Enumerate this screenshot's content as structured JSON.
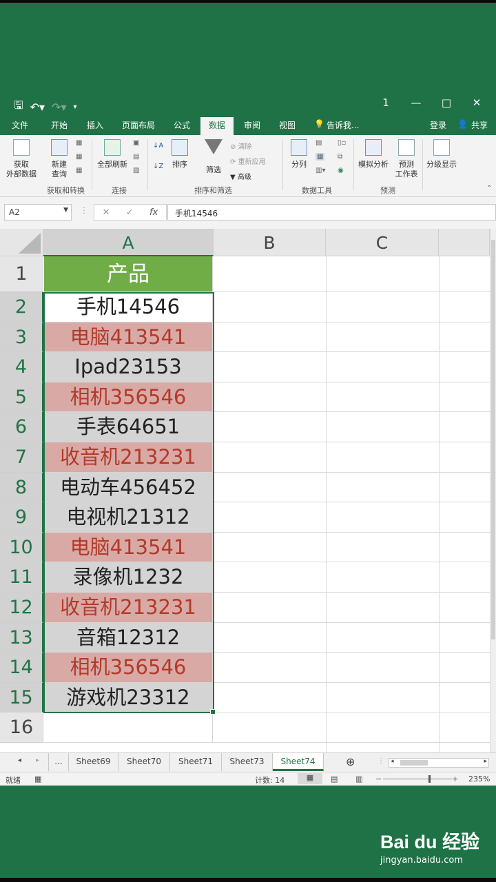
{
  "titlebar": {
    "undo_icon": "undo-icon",
    "redo_icon": "redo-icon",
    "minimize": "1",
    "restore": "□",
    "close": "✕"
  },
  "tabs": {
    "items": [
      "文件",
      "开始",
      "插入",
      "页面布局",
      "公式",
      "数据",
      "审阅",
      "视图"
    ],
    "active": "数据",
    "tell_me": "告诉我...",
    "login": "登录",
    "share": "共享"
  },
  "ribbon": {
    "get_data": "获取\n外部数据",
    "new_query": "新建\n查询",
    "group_get": "获取和转换",
    "refresh_all": "全部刷新",
    "group_conn": "连接",
    "sort": "排序",
    "filter": "筛选",
    "clear": "清除",
    "reapply": "重新应用",
    "advanced": "高级",
    "group_sort": "排序和筛选",
    "text_to_columns": "分列",
    "group_tools": "数据工具",
    "what_if": "模拟分析",
    "forecast": "预测\n工作表",
    "group_forecast": "预测",
    "outline": "分级显示"
  },
  "formula_bar": {
    "name_box": "A2",
    "cancel": "✕",
    "enter": "✓",
    "fx": "fx",
    "content": "手机14546"
  },
  "grid": {
    "columns": [
      "A",
      "B",
      "C"
    ],
    "rows": [
      {
        "num": "1",
        "value": "产品",
        "style": "header"
      },
      {
        "num": "2",
        "value": "手机14546",
        "style": "white"
      },
      {
        "num": "3",
        "value": "电脑413541",
        "style": "pink"
      },
      {
        "num": "4",
        "value": "Ipad23153",
        "style": "gray"
      },
      {
        "num": "5",
        "value": "相机356546",
        "style": "pink"
      },
      {
        "num": "6",
        "value": "手表64651",
        "style": "gray"
      },
      {
        "num": "7",
        "value": "收音机213231",
        "style": "pink"
      },
      {
        "num": "8",
        "value": "电动车456452",
        "style": "gray"
      },
      {
        "num": "9",
        "value": "电视机21312",
        "style": "gray"
      },
      {
        "num": "10",
        "value": "电脑413541",
        "style": "pink"
      },
      {
        "num": "11",
        "value": "录像机1232",
        "style": "gray"
      },
      {
        "num": "12",
        "value": "收音机213231",
        "style": "pink"
      },
      {
        "num": "13",
        "value": "音箱12312",
        "style": "gray"
      },
      {
        "num": "14",
        "value": "相机356546",
        "style": "pink"
      },
      {
        "num": "15",
        "value": "游戏机23312",
        "style": "gray"
      },
      {
        "num": "16",
        "value": "",
        "style": "empty"
      }
    ]
  },
  "sheets": {
    "ellipsis": "...",
    "items": [
      "Sheet69",
      "Sheet70",
      "Sheet71",
      "Sheet73",
      "Sheet74"
    ],
    "active": "Sheet74"
  },
  "statusbar": {
    "ready": "就绪",
    "count": "计数: 14",
    "zoom": "235%"
  },
  "watermark": {
    "logo": "Bai du 经验",
    "url": "jingyan.baidu.com"
  },
  "colors": {
    "excel_green": "#217346",
    "header_fill": "#70ad47",
    "duplicate_fill": "#d9a9a5",
    "duplicate_text": "#b23a2a",
    "gray_fill": "#d4d4d4"
  }
}
